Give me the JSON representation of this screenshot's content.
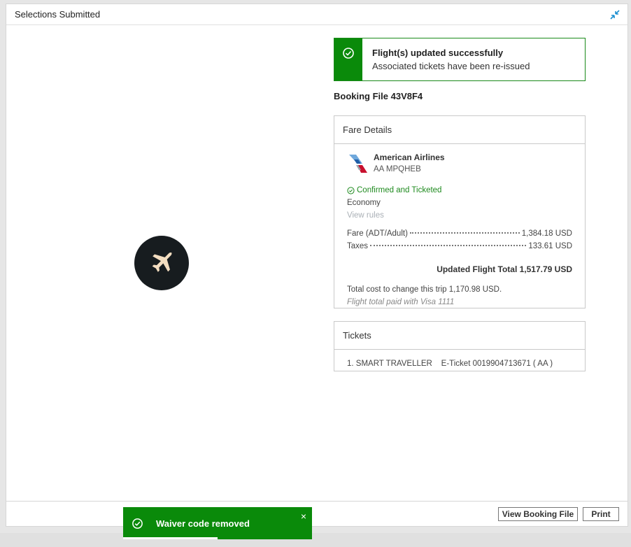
{
  "modal": {
    "title": "Selections Submitted"
  },
  "banner": {
    "title": "Flight(s) updated successfully",
    "subtitle": "Associated tickets have been re-issued"
  },
  "booking_file": "Booking File 43V8F4",
  "fare": {
    "header": "Fare Details",
    "airline": "American Airlines",
    "code": "AA MPQHEB",
    "status": "Confirmed and Ticketed",
    "cabin": "Economy",
    "view_rules": "View rules",
    "rows": [
      {
        "label": "Fare (ADT/Adult)",
        "amount": "1,384.18 USD"
      },
      {
        "label": "Taxes",
        "amount": "133.61 USD"
      }
    ],
    "total": "Updated Flight Total 1,517.79 USD",
    "change_cost": "Total cost to change this trip 1,170.98 USD.",
    "paid_with": "Flight total paid with Visa 1111"
  },
  "tickets": {
    "header": "Tickets",
    "row": "1. SMART TRAVELLER    E-Ticket 0019904713671 ( AA )"
  },
  "footer": {
    "view_booking": "View Booking File",
    "print": "Print"
  },
  "toast": {
    "message": "Waiver code removed",
    "close": "×",
    "progress": 0.5
  },
  "colors": {
    "success": "#0a8a0a",
    "brand_dark": "#171c1f",
    "accent": "#1a8fd1"
  }
}
